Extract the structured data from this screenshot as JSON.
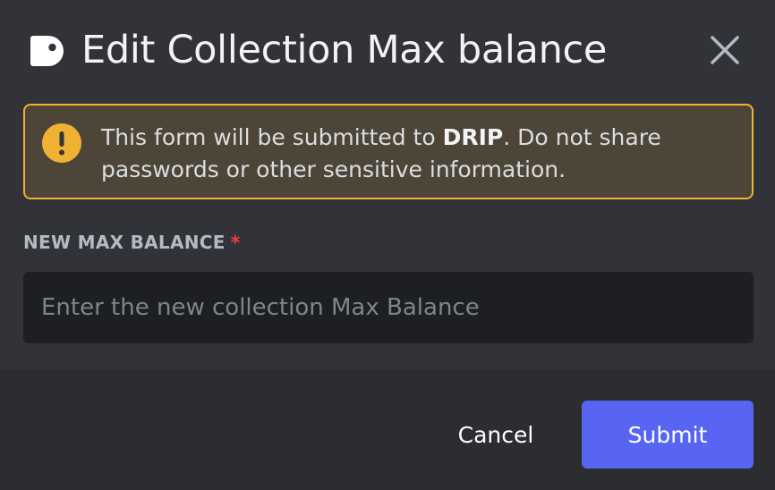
{
  "modal": {
    "title": "Edit Collection Max balance",
    "app_icon": "bot-app-icon",
    "close_icon": "close-icon"
  },
  "warning": {
    "icon": "exclamation-icon",
    "text_before": "This form will be submitted to ",
    "app_name": "DRIP",
    "text_after": ". Do not share passwords or other sensitive information.",
    "border_color": "#f0b232"
  },
  "field": {
    "label": "NEW MAX BALANCE",
    "required_mark": "*",
    "value": "",
    "placeholder": "Enter the new collection Max Balance"
  },
  "footer": {
    "cancel_label": "Cancel",
    "submit_label": "Submit",
    "submit_color": "#5865f2"
  }
}
